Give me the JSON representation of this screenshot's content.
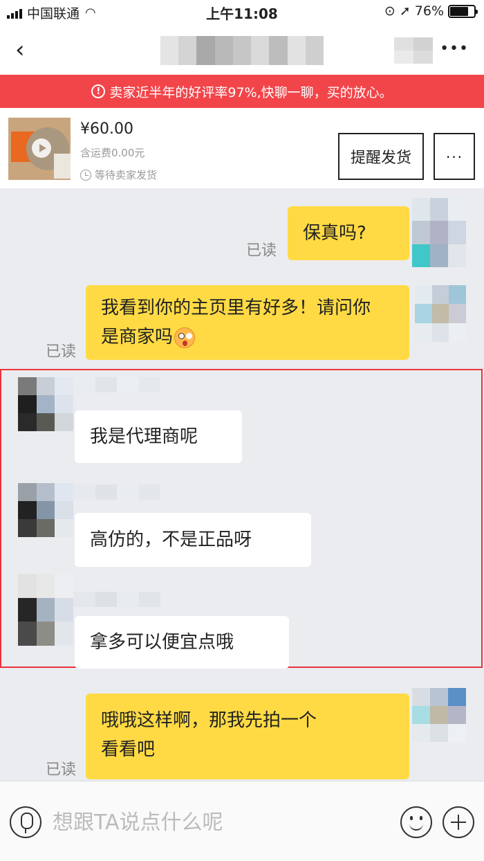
{
  "status_bar": {
    "carrier": "中国联通",
    "time": "上午11:08",
    "battery": "76%",
    "battery_level": 0.76,
    "wifi_icon": "wifi-icon",
    "location_icon": "location-arrow-icon",
    "rotation_lock_icon": "rotation-lock-icon"
  },
  "nav": {
    "back_icon": "chevron-left-icon",
    "more_icon": "more-dots-icon"
  },
  "banner": {
    "text": "卖家近半年的好评率97%,快聊一聊，买的放心。",
    "icon": "alert-circle-icon",
    "color": "#f2454a"
  },
  "product": {
    "price": "¥60.00",
    "shipping": "含运费0.00元",
    "status": "等待卖家发货",
    "remind_button": "提醒发货",
    "more_button": "···"
  },
  "messages": [
    {
      "side": "out",
      "text": "保真吗?",
      "read": "已读"
    },
    {
      "side": "out",
      "line1": "我看到你的主页里有好多！请问你",
      "line2": "是商家吗",
      "read": "已读",
      "emoji": "astonished-emoji"
    },
    {
      "side": "in",
      "text": "我是代理商呢"
    },
    {
      "side": "in",
      "text": "高仿的，不是正品呀"
    },
    {
      "side": "in",
      "text": "拿多可以便宜点哦"
    },
    {
      "side": "out",
      "line1": "哦哦这样啊，那我先拍一个",
      "line2": "看看吧",
      "read": "已读"
    }
  ],
  "input": {
    "placeholder": "想跟TA说点什么呢"
  },
  "colors": {
    "accent_yellow": "#ffda44",
    "highlight_red": "#e8333b",
    "background": "#ebecf0"
  }
}
